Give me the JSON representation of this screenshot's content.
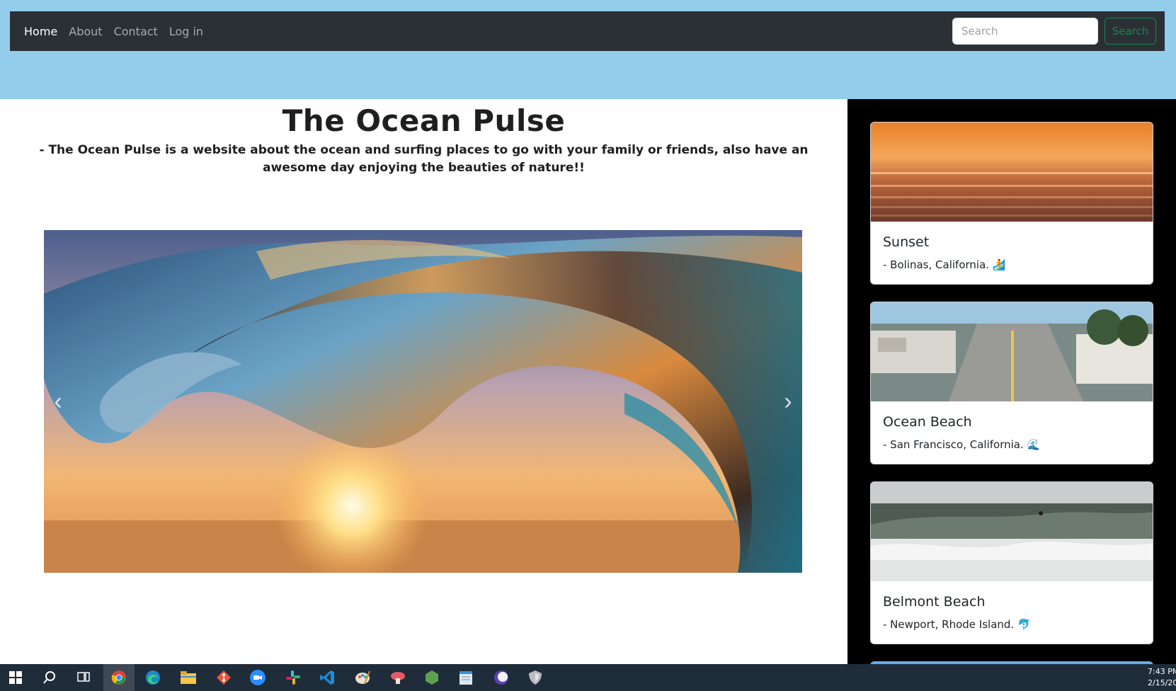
{
  "navbar": {
    "links": [
      {
        "label": "Home",
        "active": true
      },
      {
        "label": "About",
        "active": false
      },
      {
        "label": "Contact",
        "active": false
      },
      {
        "label": "Log in",
        "active": false
      }
    ],
    "search": {
      "placeholder": "Search",
      "value": "",
      "button_label": "Search"
    }
  },
  "main": {
    "title": "The Ocean Pulse",
    "subtitle": "- The Ocean Pulse is a website about the ocean and surfing places to go with your family or friends, also have an awesome day enjoying the beauties of nature!!",
    "carousel": {
      "image": "wave-sunset-image",
      "prev_icon": "chevron-left-icon",
      "next_icon": "chevron-right-icon"
    }
  },
  "sidebar": {
    "cards": [
      {
        "title": "Sunset",
        "text": "- Bolinas, California. 🏄",
        "image": "sunset-ocean-image"
      },
      {
        "title": "Ocean Beach",
        "text": "- San Francisco, California. 🌊",
        "image": "ocean-beach-street-image"
      },
      {
        "title": "Belmont Beach",
        "text": "- Newport, Rhode Island. 🐬",
        "image": "belmont-beach-surf-image"
      }
    ]
  },
  "taskbar": {
    "icons": [
      "windows-start-icon",
      "search-icon",
      "task-view-icon",
      "chrome-icon",
      "edge-icon",
      "file-explorer-icon",
      "git-icon",
      "zoom-icon",
      "slack-icon",
      "vscode-icon",
      "paint-icon",
      "mushroom-app-icon",
      "nodejs-icon",
      "notepad-icon",
      "eclipse-icon",
      "shield-app-icon"
    ],
    "time": "7:43 PM",
    "date": "2/15/20"
  },
  "colors": {
    "navbar_bg": "#2b3035",
    "page_bg": "#93cdec",
    "search_accent": "#198754",
    "sidebar_bg": "#000000"
  }
}
